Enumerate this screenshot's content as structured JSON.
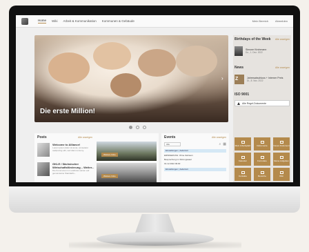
{
  "nav": {
    "items": [
      "Home",
      "Wiki",
      "Arbeit & Kommunikation",
      "Kommunen & Gebäude"
    ],
    "top_right": [
      "Mein Bereich",
      "Abmelden"
    ]
  },
  "hero": {
    "title": "Die erste Million!"
  },
  "birthdays": {
    "title": "Birthdays of the Week",
    "more": "Alle anzeigen",
    "person_name": "Simone Kirchmann",
    "person_date": "Do., 1. Dez. 2022"
  },
  "news": {
    "title": "News",
    "more": "Alle anzeigen",
    "thumb_text": "Z",
    "item_title": "Jahresabschluss + Interner Preis",
    "item_date": "Di., 8. Nov. 2022"
  },
  "iso": {
    "title": "ISO 9001",
    "box_text": "Alle Regel-Dokumente"
  },
  "tiles": [
    "Mein Arbeitsplatz",
    "Dokumente",
    "Neues Dokument",
    "Kalender",
    "Formulare",
    "Meine Aufgaben",
    "Kontakte",
    "Bereiche",
    "Wiki",
    "",
    "",
    ""
  ],
  "posts": {
    "title": "Posts",
    "more": "Alle anzeigen",
    "items": [
      {
        "title": "Welcome to Alliance!",
        "text": "Lorem ipsum dolor sit amet, consetetur sadipscing elitr, sed diam nonumy."
      },
      {
        "title": "GKLE / Sächsischer Wirtschaftsförderung – Weiter...",
        "text": "Die Kommunen im Landkreis setzen auf gemeinsame Standards..."
      }
    ],
    "photo_labels": [
      "Weitere Infos",
      "Weitere Infos"
    ]
  },
  "events": {
    "title": "Events",
    "more": "Alle anzeigen",
    "filter": "Alle",
    "items": [
      {
        "tag": "Einstellungen | Jederzeit",
        "line1": "ERINNERUNG: Ohne Zeitraum",
        "line2": "Besprechung im Sitzungssaal",
        "line3": "01.12.2022 09:00"
      },
      {
        "tag": "Einstellungen | Jederzeit",
        "line1": "",
        "line2": "",
        "line3": ""
      }
    ]
  }
}
